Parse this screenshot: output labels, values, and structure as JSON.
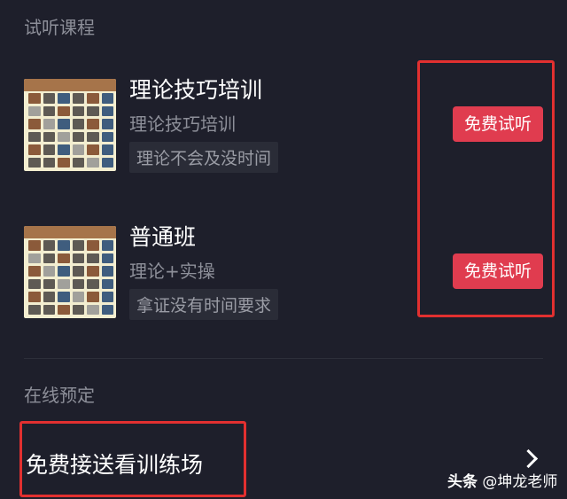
{
  "trial_section": {
    "title": "试听课程",
    "courses": [
      {
        "name": "理论技巧培训",
        "subtitle": "理论技巧培训",
        "tag": "理论不会及没时间",
        "button_label": "免费试听"
      },
      {
        "name": "普通班",
        "subtitle": "理论+实操",
        "tag": "拿证没有时间要求",
        "button_label": "免费试听"
      }
    ]
  },
  "booking_section": {
    "title": "在线预定",
    "link_label": "免费接送看训练场"
  },
  "watermark": {
    "brand": "头条",
    "handle": "@坤龙老师"
  },
  "colors": {
    "background": "#1e1f2b",
    "button": "#e03c4f",
    "highlight_box": "#e23030",
    "muted_text": "#8d8f99"
  }
}
